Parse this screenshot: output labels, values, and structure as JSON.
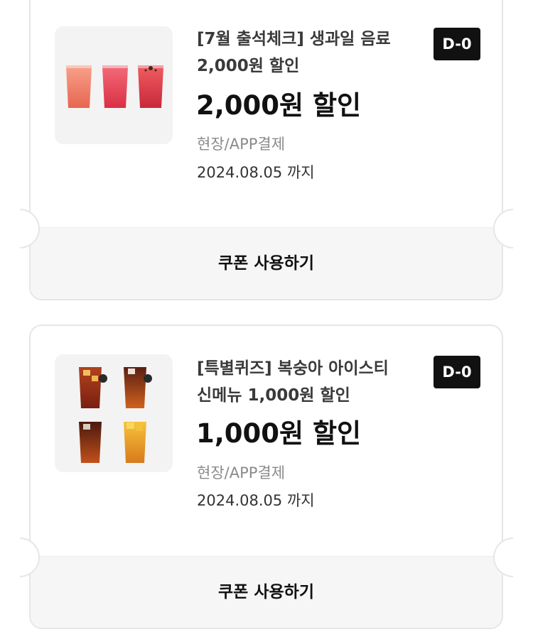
{
  "coupons": [
    {
      "title_line1": "[7월 출석체크] 생과일 음료",
      "title_line2": "2,000원 할인",
      "badge": "D-0",
      "amount": "2,000원 할인",
      "method": "현장/APP결제",
      "expiry": "2024.08.05 까지",
      "use_label": "쿠폰 사용하기",
      "image": "three-fruit-juice-cups"
    },
    {
      "title_line1": "[특별퀴즈] 복숭아 아이스티",
      "title_line2": "신메뉴 1,000원 할인",
      "badge": "D-0",
      "amount": "1,000원 할인",
      "method": "현장/APP결제",
      "expiry": "2024.08.05 까지",
      "use_label": "쿠폰 사용하기",
      "image": "four-iced-tea-cups"
    }
  ],
  "colors": {
    "badge_bg": "#111111",
    "button_bg": "#f6f6f6",
    "border": "#e6e6e6",
    "muted_text": "#8a8a8a"
  }
}
